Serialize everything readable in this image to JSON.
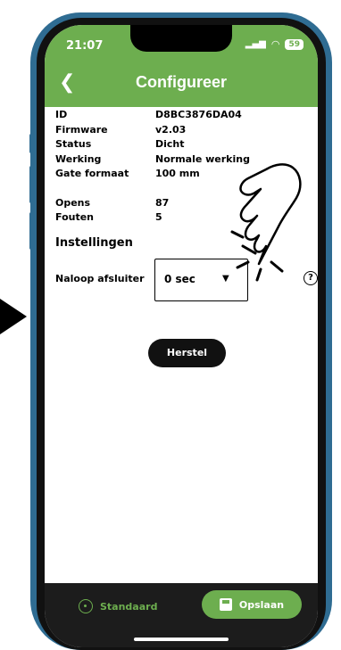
{
  "status_bar": {
    "time": "21:07",
    "battery": "59"
  },
  "header": {
    "title": "Configureer",
    "back_icon": "chevron-left-icon"
  },
  "info": [
    {
      "label": "ID",
      "value": "D8BC3876DA04"
    },
    {
      "label": "Firmware",
      "value": "v2.03"
    },
    {
      "label": "Status",
      "value": "Dicht"
    },
    {
      "label": "Werking",
      "value": "Normale werking"
    },
    {
      "label": "Gate formaat",
      "value": "100 mm"
    }
  ],
  "counters": [
    {
      "label": "Opens",
      "value": "87"
    },
    {
      "label": "Fouten",
      "value": "5"
    }
  ],
  "settings": {
    "title": "Instellingen",
    "naloop_label": "Naloop afsluiter",
    "naloop_value": "0 sec",
    "help_icon": "question-circle-icon"
  },
  "reset_button": "Herstel",
  "footer": {
    "standaard": "Standaard",
    "opslaan": "Opslaan"
  },
  "colors": {
    "accent": "#6dae4f",
    "frame": "#2f6c92"
  }
}
